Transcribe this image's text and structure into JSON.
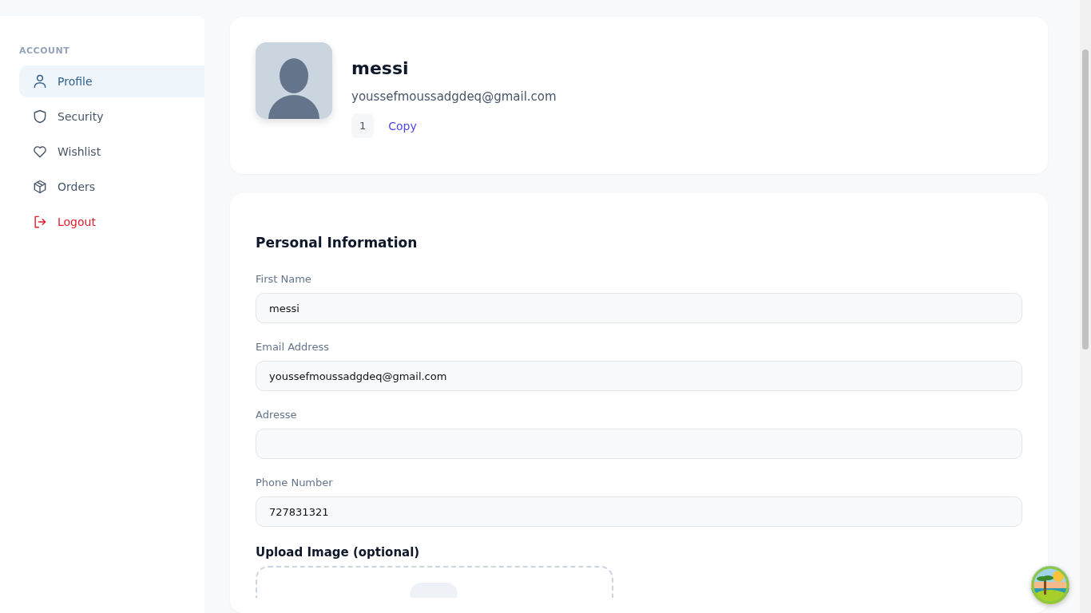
{
  "sidebar": {
    "heading": "ACCOUNT",
    "items": [
      {
        "label": "Profile",
        "kind": "normal",
        "selected": true
      },
      {
        "label": "Security",
        "kind": "normal",
        "selected": false
      },
      {
        "label": "Wishlist",
        "kind": "normal",
        "selected": false
      },
      {
        "label": "Orders",
        "kind": "normal",
        "selected": false
      },
      {
        "label": "Logout",
        "kind": "danger",
        "selected": false
      }
    ]
  },
  "profile": {
    "name": "messi",
    "email": "youssefmoussadgdeq@gmail.com",
    "id": "1",
    "copy": "Copy"
  },
  "form": {
    "title": "Personal Information",
    "fields": [
      {
        "label": "First Name",
        "value": "messi"
      },
      {
        "label": "Email Address",
        "value": "youssefmoussadgdeq@gmail.com"
      },
      {
        "label": "Adresse"
      },
      {
        "label": "Phone Number",
        "value": "727831321"
      }
    ],
    "upload_title": "Upload Image (optional)"
  }
}
